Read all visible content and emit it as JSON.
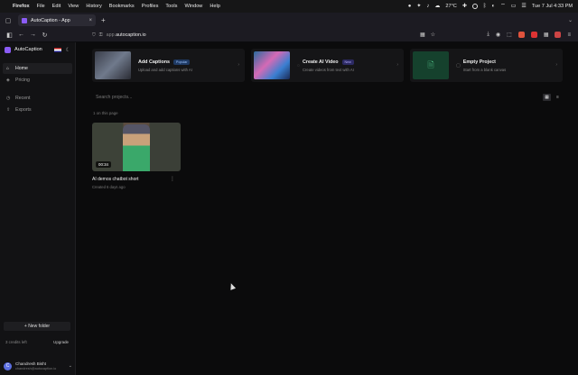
{
  "menubar": {
    "app": "Firefox",
    "items": [
      "File",
      "Edit",
      "View",
      "History",
      "Bookmarks",
      "Profiles",
      "Tools",
      "Window",
      "Help"
    ],
    "temperature": "27°C",
    "datetime": "Tue 7 Jul  4:33 PM"
  },
  "browser": {
    "tab_title": "AutoCaption - App",
    "url_prefix": "app.",
    "url_host": "autocaption.io"
  },
  "sidebar": {
    "brand": "AutoCaption",
    "items": [
      {
        "label": "Home",
        "icon": "home-icon"
      },
      {
        "label": "Pricing",
        "icon": "pricing-icon"
      },
      {
        "label": "Recent",
        "icon": "clock-icon"
      },
      {
        "label": "Exports",
        "icon": "export-icon"
      }
    ],
    "new_folder": "+ New folder",
    "credits": "3 credits left",
    "upgrade": "Upgrade",
    "user_name": "Chandresh Bisht",
    "user_email": "chandresh@autocaption.io",
    "user_initial": "C"
  },
  "cards": [
    {
      "title": "Add Captions",
      "badge": "Popular",
      "desc": "Upload and add captions with AI"
    },
    {
      "title": "Create AI Video",
      "badge": "New",
      "desc": "Create videos from text with AI"
    },
    {
      "title": "Empty Project",
      "badge": "",
      "desc": "Start from a blank canvas"
    }
  ],
  "search": {
    "placeholder": "Search projects..."
  },
  "projects_count": "1 on this page",
  "project": {
    "title": "AI demos chatbot short",
    "date": "Created 6 days ago",
    "duration": "00:34"
  },
  "colors": {
    "accent": "#8b5cf6",
    "background": "#0b0b0c",
    "sidebar": "#121214"
  }
}
